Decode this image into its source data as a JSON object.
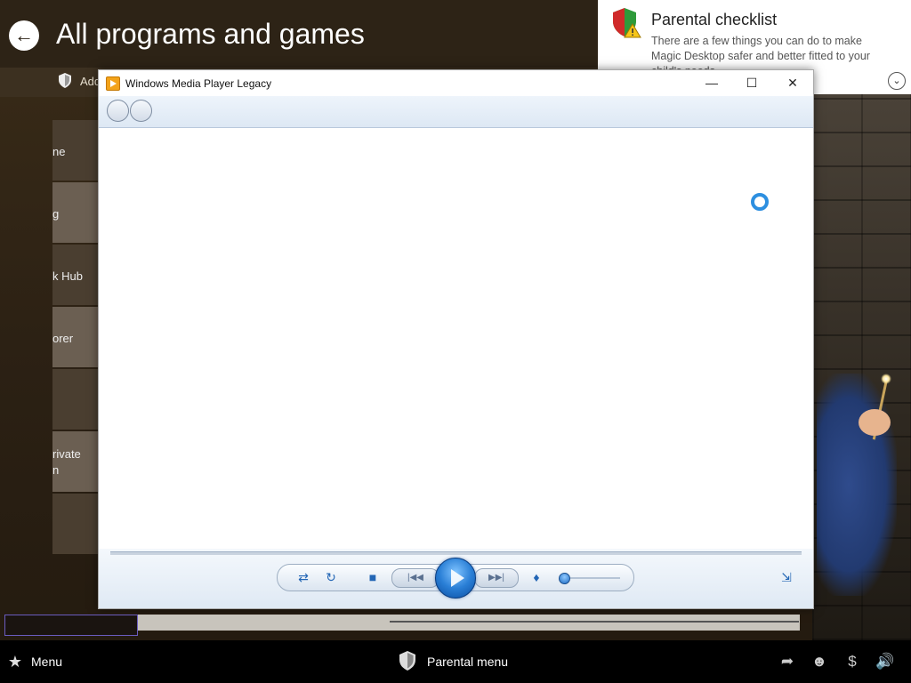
{
  "header": {
    "back_icon": "back-arrow-icon",
    "title": "All programs and games"
  },
  "subbar": {
    "label": "Add"
  },
  "tiles": [
    {
      "label": "ne"
    },
    {
      "label": "g"
    },
    {
      "label": "k Hub"
    },
    {
      "label": "orer"
    },
    {
      "label": ""
    },
    {
      "label": "rivate",
      "label2": "n"
    },
    {
      "label": ""
    }
  ],
  "checklist": {
    "title": "Parental checklist",
    "text": "There are a few things you can do to make Magic Desktop safer and better fitted to your child's needs.",
    "expand_icon": "chevron-down-icon"
  },
  "wmp": {
    "title": "Windows Media Player Legacy",
    "min": "—",
    "max": "☐",
    "close": "✕",
    "controls": {
      "shuffle": "⇄",
      "repeat": "↻",
      "stop": "■",
      "prev": "|◀◀",
      "next": "▶▶|",
      "mute": "🔈",
      "switch_view": "⇲",
      "volume_level": 0.05
    }
  },
  "taskbar": {
    "menu_label": "Menu",
    "parental_menu_label": "Parental menu",
    "tray_icons": [
      "share-icon",
      "monkey-icon",
      "money-icon",
      "volume-icon"
    ]
  },
  "colors": {
    "accent_blue": "#2a7fd6",
    "background": "#2d2316"
  }
}
